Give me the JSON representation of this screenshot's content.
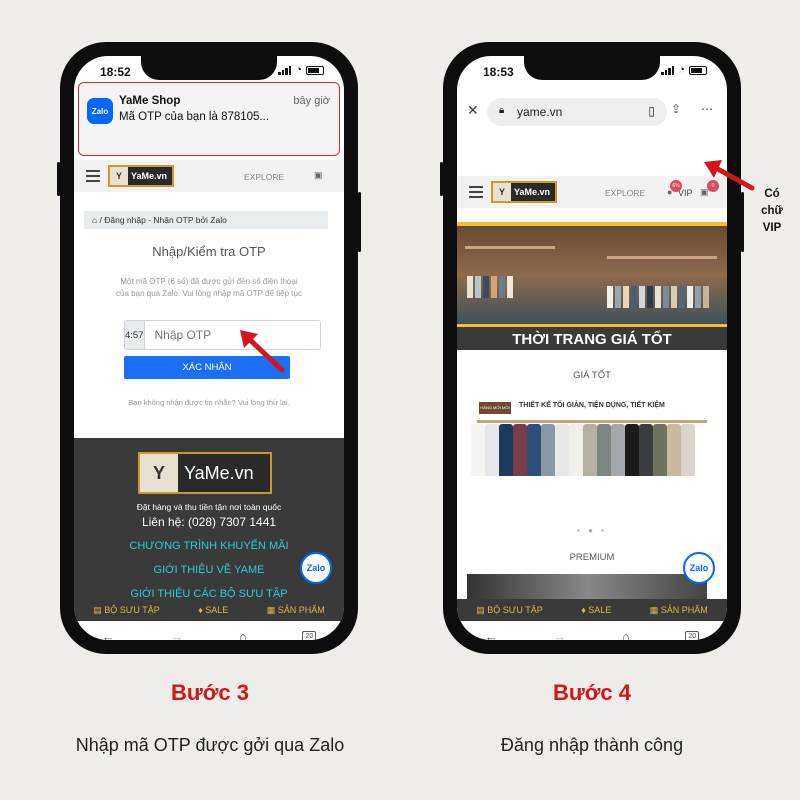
{
  "left_phone": {
    "status_time": "18:52",
    "notification": {
      "app_icon": "Zalo",
      "title": "YaMe Shop",
      "time": "bây giờ",
      "body": "Mã OTP của bạn là 878105..."
    },
    "header": {
      "logo_text": "YaMe.vn",
      "explore": "EXPLORE"
    },
    "breadcrumb": "Đăng nhập - Nhận OTP bởi Zalo",
    "otp_title": "Nhập/Kiểm tra OTP",
    "otp_desc": "Một mã OTP (6 số) đã được gửi đến số điện thoại của bạn qua Zalo. Vui lòng nhập mã OTP để tiếp tục",
    "otp_timer": "4:57",
    "otp_placeholder": "Nhập OTP",
    "confirm_button": "XÁC NHẬN",
    "otp_footer": "Bạn không nhận được tin nhắn? Vui lòng thử lại.",
    "footer": {
      "logo_text": "YaMe.vn",
      "tagline": "Đặt hàng và thu tiền tận nơi toàn quốc",
      "contact": "Liên hệ: (028) 7307 1441",
      "links": [
        "CHƯƠNG TRÌNH KHUYẾN MÃI",
        "GIỚI THIỆU VỀ YAME",
        "GIỚI THIỆU CÁC BỘ SƯU TẬP"
      ]
    },
    "zalo_float": "Zalo",
    "bottom_nav": [
      "BỘ SƯU TẬP",
      "SALE",
      "SẢN PHẨM"
    ],
    "tab_count": "20"
  },
  "right_phone": {
    "status_time": "18:53",
    "url": "yame.vn",
    "header": {
      "logo_text": "YaMe.vn",
      "explore": "EXPLORE",
      "vip": "VIP",
      "badge_user": "6%",
      "badge_cart": "0"
    },
    "banner_text": "THỜI TRANG GIÁ TỐT",
    "section_gia_tot": "GIÁ TỐT",
    "promo_tag": "HÀNG MỚI MỖI NGÀY",
    "promo_text": "THIẾT KẾ TỐI GIẢN, TIỆN DỤNG, TIẾT KIỆM",
    "section_premium": "PREMIUM",
    "zalo_float": "Zalo",
    "bottom_nav": [
      "BỘ SƯU TẬP",
      "SALE",
      "SẢN PHẨM"
    ],
    "tab_count": "20"
  },
  "annotation": [
    "Có",
    "chữ",
    "VIP"
  ],
  "steps": [
    {
      "title": "Bước 3",
      "desc": "Nhập mã OTP được gởi qua Zalo"
    },
    {
      "title": "Bước 4",
      "desc": "Đăng nhập thành công"
    }
  ],
  "colors": {
    "accent_red": "#d3151c",
    "zalo_blue": "#0068ff",
    "button_blue": "#1a6ff5",
    "gold": "#c89a2c"
  }
}
